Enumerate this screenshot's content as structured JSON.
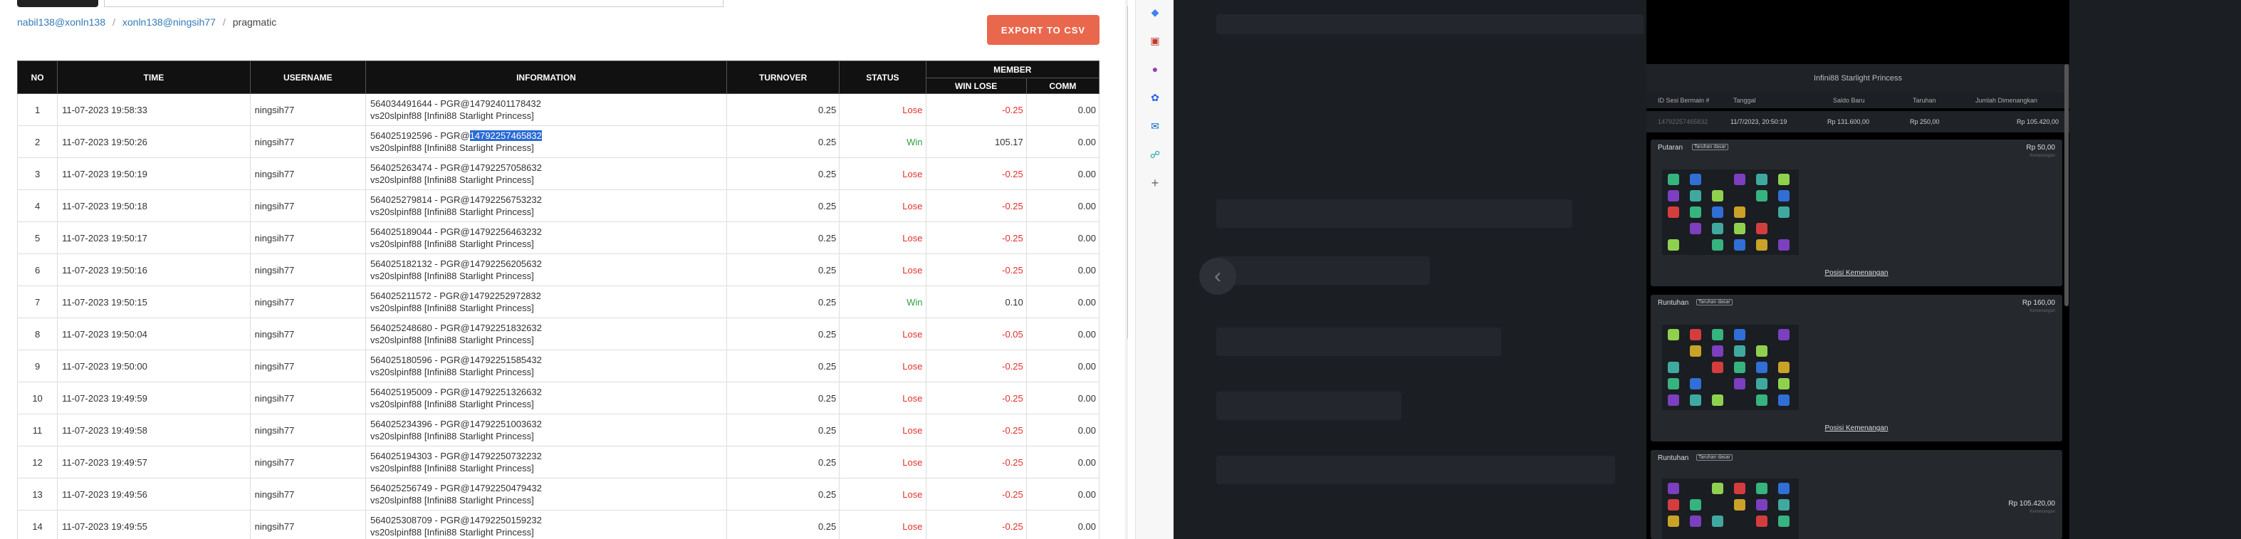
{
  "breadcrumb": {
    "items": [
      "nabil138@xonln138",
      "xonln138@ningsih77",
      "pragmatic"
    ],
    "sep": "/"
  },
  "export_label": "EXPORT TO CSV",
  "table": {
    "headers": {
      "no": "NO",
      "time": "TIME",
      "username": "USERNAME",
      "information": "INFORMATION",
      "turnover": "TURNOVER",
      "status": "STATUS",
      "member": "MEMBER",
      "winlose": "WIN LOSE",
      "comm": "COMM"
    },
    "rows": [
      {
        "no": "1",
        "time": "11-07-2023 19:58:33",
        "user": "ningsih77",
        "info1": "564034491644 - PGR@14792401178432",
        "info2": "vs20slpinf88 [Infini88 Starlight Princess]",
        "turnover": "0.25",
        "status": "Lose",
        "winlose": "-0.25",
        "comm": "0.00"
      },
      {
        "no": "2",
        "time": "11-07-2023 19:50:26",
        "user": "ningsih77",
        "info1": "564025192596 - PGR@",
        "info1_hl": "14792257465832",
        "info2": "vs20slpinf88 [Infini88 Starlight Princess]",
        "turnover": "0.25",
        "status": "Win",
        "winlose": "105.17",
        "comm": "0.00"
      },
      {
        "no": "3",
        "time": "11-07-2023 19:50:19",
        "user": "ningsih77",
        "info1": "564025263474 - PGR@14792257058632",
        "info2": "vs20slpinf88 [Infini88 Starlight Princess]",
        "turnover": "0.25",
        "status": "Lose",
        "winlose": "-0.25",
        "comm": "0.00"
      },
      {
        "no": "4",
        "time": "11-07-2023 19:50:18",
        "user": "ningsih77",
        "info1": "564025279814 - PGR@14792256753232",
        "info2": "vs20slpinf88 [Infini88 Starlight Princess]",
        "turnover": "0.25",
        "status": "Lose",
        "winlose": "-0.25",
        "comm": "0.00"
      },
      {
        "no": "5",
        "time": "11-07-2023 19:50:17",
        "user": "ningsih77",
        "info1": "564025189044 - PGR@14792256463232",
        "info2": "vs20slpinf88 [Infini88 Starlight Princess]",
        "turnover": "0.25",
        "status": "Lose",
        "winlose": "-0.25",
        "comm": "0.00"
      },
      {
        "no": "6",
        "time": "11-07-2023 19:50:16",
        "user": "ningsih77",
        "info1": "564025182132 - PGR@14792256205632",
        "info2": "vs20slpinf88 [Infini88 Starlight Princess]",
        "turnover": "0.25",
        "status": "Lose",
        "winlose": "-0.25",
        "comm": "0.00"
      },
      {
        "no": "7",
        "time": "11-07-2023 19:50:15",
        "user": "ningsih77",
        "info1": "564025211572 - PGR@14792252972832",
        "info2": "vs20slpinf88 [Infini88 Starlight Princess]",
        "turnover": "0.25",
        "status": "Win",
        "winlose": "0.10",
        "comm": "0.00"
      },
      {
        "no": "8",
        "time": "11-07-2023 19:50:04",
        "user": "ningsih77",
        "info1": "564025248680 - PGR@14792251832632",
        "info2": "vs20slpinf88 [Infini88 Starlight Princess]",
        "turnover": "0.25",
        "status": "Lose",
        "winlose": "-0.05",
        "comm": "0.00"
      },
      {
        "no": "9",
        "time": "11-07-2023 19:50:00",
        "user": "ningsih77",
        "info1": "564025180596 - PGR@14792251585432",
        "info2": "vs20slpinf88 [Infini88 Starlight Princess]",
        "turnover": "0.25",
        "status": "Lose",
        "winlose": "-0.25",
        "comm": "0.00"
      },
      {
        "no": "10",
        "time": "11-07-2023 19:49:59",
        "user": "ningsih77",
        "info1": "564025195009 - PGR@14792251326632",
        "info2": "vs20slpinf88 [Infini88 Starlight Princess]",
        "turnover": "0.25",
        "status": "Lose",
        "winlose": "-0.25",
        "comm": "0.00"
      },
      {
        "no": "11",
        "time": "11-07-2023 19:49:58",
        "user": "ningsih77",
        "info1": "564025234396 - PGR@14792251003632",
        "info2": "vs20slpinf88 [Infini88 Starlight Princess]",
        "turnover": "0.25",
        "status": "Lose",
        "winlose": "-0.25",
        "comm": "0.00"
      },
      {
        "no": "12",
        "time": "11-07-2023 19:49:57",
        "user": "ningsih77",
        "info1": "564025194303 - PGR@14792250732232",
        "info2": "vs20slpinf88 [Infini88 Starlight Princess]",
        "turnover": "0.25",
        "status": "Lose",
        "winlose": "-0.25",
        "comm": "0.00"
      },
      {
        "no": "13",
        "time": "11-07-2023 19:49:56",
        "user": "ningsih77",
        "info1": "564025256749 - PGR@14792250479432",
        "info2": "vs20slpinf88 [Infini88 Starlight Princess]",
        "turnover": "0.25",
        "status": "Lose",
        "winlose": "-0.25",
        "comm": "0.00"
      },
      {
        "no": "14",
        "time": "11-07-2023 19:49:55",
        "user": "ningsih77",
        "info1": "564025308709 - PGR@14792250159232",
        "info2": "vs20slpinf88 [Infini88 Starlight Princess]",
        "turnover": "0.25",
        "status": "Lose",
        "winlose": "-0.25",
        "comm": "0.00"
      }
    ]
  },
  "edge_icons": [
    "tag-icon",
    "briefcase-icon",
    "people-icon",
    "copilot-icon",
    "outlook-icon",
    "shopping-icon",
    "plus-icon"
  ],
  "modal": {
    "title": "Infini88 Starlight Princess",
    "cols": [
      "ID Sesi Bermain #",
      "Tanggal",
      "Saldo Baru",
      "Taruhan",
      "Jumlah Dimenangkan"
    ],
    "vals": [
      "14792257465832",
      "11/7/2023, 20:50:19",
      "Rp 131.600,00",
      "Rp 250,00",
      "Rp 105.420,00"
    ],
    "panels": [
      {
        "title": "Putaran",
        "tag": "Taruhan dasar",
        "amt": "Rp 50,00",
        "sub": "Kemenangan",
        "link": "Posisi Kemenangan"
      },
      {
        "title": "Runtuhan",
        "tag": "Taruhan dasar",
        "amt": "Rp 160,00",
        "sub": "Kemenangan",
        "link": "Posisi Kemenangan"
      },
      {
        "title": "Runtuhan",
        "tag": "Taruhan dasar",
        "amt": "Rp 105.420,00",
        "sub": "Kemenangan"
      }
    ]
  }
}
